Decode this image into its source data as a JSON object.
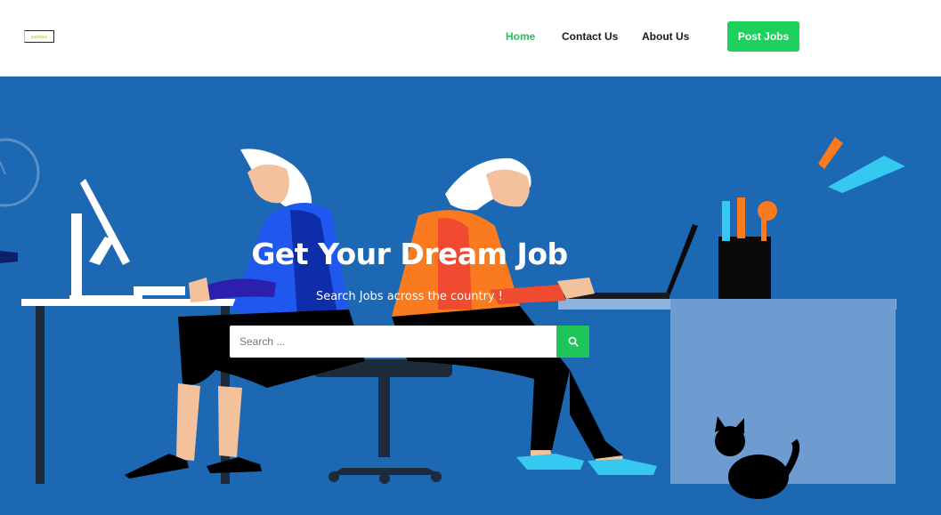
{
  "brand": {
    "logo_text": "JobsMate",
    "logo_icon": "brand-logo"
  },
  "nav": {
    "items": [
      {
        "label": "Home",
        "active": true
      },
      {
        "label": "Contact Us",
        "active": false
      },
      {
        "label": "About Us",
        "active": false
      }
    ],
    "post_jobs_label": "Post Jobs"
  },
  "hero": {
    "title": "Get Your Dream Job",
    "subtitle": "Search Jobs across the country !",
    "search": {
      "placeholder": "Search ...",
      "value": "",
      "button_icon": "search-icon"
    }
  },
  "colors": {
    "accent": "#1ed15c",
    "hero_background": "#1d68b3",
    "active_nav": "#2ebd63"
  }
}
